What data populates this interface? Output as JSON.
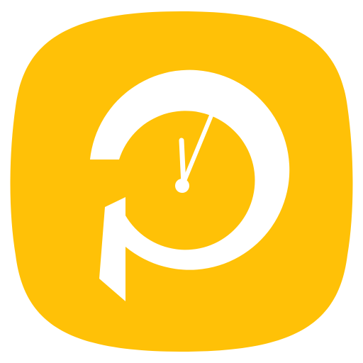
{
  "app_icon": {
    "name": "clock-p-logo",
    "colors": {
      "background": "#ffffff",
      "squircle": "#ffc107",
      "glyph": "#ffffff"
    },
    "icons": [
      "squircle-background-icon",
      "letter-p-clock-icon"
    ]
  }
}
